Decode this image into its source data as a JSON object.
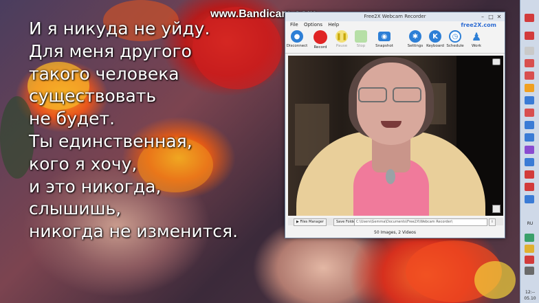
{
  "watermark": "www.Bandicam.com",
  "lyrics": [
    "И я никуда не уйду.",
    "Для меня другого",
    "такого человека",
    "существовать",
    "не будет.",
    "Ты единственная,",
    "кого я хочу,",
    "и это никогда,",
    "слышишь,",
    "никогда не изменится."
  ],
  "window": {
    "title": "Free2X Webcam Recorder",
    "minimize": "–",
    "maximize": "□",
    "close": "✕",
    "menu": [
      "File",
      "Options",
      "Help"
    ],
    "brand": "free2X.com",
    "tools": [
      {
        "label": "Disconnect",
        "icon": "webcam-icon",
        "color": "#2d7fd6",
        "enabled": true
      },
      {
        "label": "Record",
        "icon": "record-icon",
        "color": "#e02424",
        "enabled": true
      },
      {
        "label": "Pause",
        "icon": "pause-icon",
        "color": "#f3e17a",
        "enabled": false
      },
      {
        "label": "Stop",
        "icon": "stop-icon",
        "color": "#b6dfa6",
        "enabled": false
      },
      {
        "label": "Snapshot",
        "icon": "camera-icon",
        "color": "#2d7fd6",
        "enabled": true
      },
      {
        "label": "Settings",
        "icon": "gear-icon",
        "color": "#2d7fd6",
        "enabled": true
      },
      {
        "label": "Keyboard",
        "icon": "keyboard-icon",
        "color": "#2d7fd6",
        "enabled": true
      },
      {
        "label": "Schedule",
        "icon": "clock-icon",
        "color": "#2d7fd6",
        "enabled": true
      },
      {
        "label": "Work",
        "icon": "person-icon",
        "color": "#2d7fd6",
        "enabled": true
      }
    ],
    "files_manager": "Files Manager",
    "save_folder": "Save Folder",
    "save_path": "C:\\Users\\Gemma\\Documents\\Free2X\\Webcam Recorder\\",
    "status": "50 Images, 2 Videos"
  },
  "taskbar": {
    "language": "RU",
    "clock": "12:--",
    "date": "05.10"
  },
  "colors": {
    "accent": "#2d7fd6",
    "record": "#e02424"
  }
}
